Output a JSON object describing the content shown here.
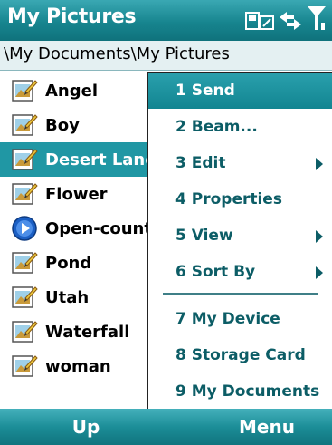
{
  "titlebar": {
    "title": "My Pictures",
    "status_icons": [
      "connectivity-icon",
      "data-transfer-icon",
      "signal-strength-icon"
    ]
  },
  "path": "\\My Documents\\My Pictures",
  "files": [
    {
      "name": "Angel",
      "icon": "picture-icon",
      "selected": false
    },
    {
      "name": "Boy",
      "icon": "picture-icon",
      "selected": false
    },
    {
      "name": "Desert Landscape",
      "icon": "picture-icon",
      "selected": true
    },
    {
      "name": "Flower",
      "icon": "picture-icon",
      "selected": false
    },
    {
      "name": "Open-county",
      "icon": "media-player-icon",
      "selected": false
    },
    {
      "name": "Pond",
      "icon": "picture-icon",
      "selected": false
    },
    {
      "name": "Utah",
      "icon": "picture-icon",
      "selected": false
    },
    {
      "name": "Waterfall",
      "icon": "picture-icon",
      "selected": false
    },
    {
      "name": "woman",
      "icon": "picture-icon",
      "selected": false
    }
  ],
  "menu": {
    "items": [
      {
        "label": "1 Send",
        "submenu": false,
        "highlighted": true
      },
      {
        "label": "2 Beam...",
        "submenu": false,
        "highlighted": false
      },
      {
        "label": "3 Edit",
        "submenu": true,
        "highlighted": false
      },
      {
        "label": "4 Properties",
        "submenu": false,
        "highlighted": false
      },
      {
        "label": "5 View",
        "submenu": true,
        "highlighted": false
      },
      {
        "label": "6 Sort By",
        "submenu": true,
        "highlighted": false
      },
      {
        "label": "7 My Device",
        "submenu": false,
        "highlighted": false
      },
      {
        "label": "8 Storage Card",
        "submenu": false,
        "highlighted": false
      },
      {
        "label": "9 My Documents",
        "submenu": false,
        "highlighted": false
      }
    ]
  },
  "softkeys": {
    "left": "Up",
    "right": "Menu"
  },
  "colors": {
    "accent": "#17858f",
    "selection": "#2097a4",
    "menu_text": "#0c5d66"
  }
}
